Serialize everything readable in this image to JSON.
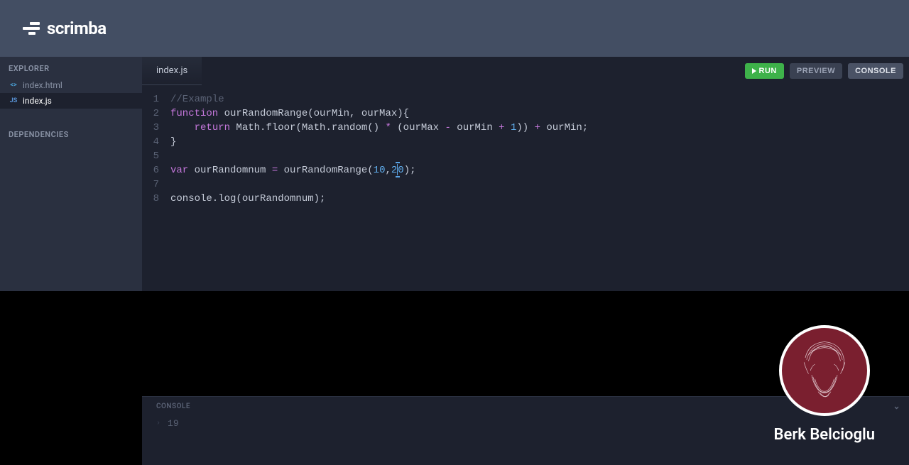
{
  "brand": "scrimba",
  "sidebar": {
    "explorer_label": "EXPLORER",
    "dependencies_label": "DEPENDENCIES",
    "files": [
      {
        "name": "index.html",
        "icon": "<>",
        "type": "html",
        "active": false
      },
      {
        "name": "index.js",
        "icon": "JS",
        "type": "js",
        "active": true
      }
    ]
  },
  "editor": {
    "active_tab": "index.js",
    "buttons": {
      "run": "RUN",
      "preview": "PREVIEW",
      "console": "CONSOLE"
    },
    "code": {
      "line1_comment": "//Example",
      "line2_kw1": "function",
      "line2_rest": " ourRandomRange(ourMin, ourMax){",
      "line3_indent": "    ",
      "line3_kw": "return",
      "line3_a": " Math.floor(Math.random() ",
      "line3_op1": "*",
      "line3_b": " (ourMax ",
      "line3_op2": "-",
      "line3_c": " ourMin ",
      "line3_op3": "+",
      "line3_d": " ",
      "line3_num": "1",
      "line3_e": ")) ",
      "line3_op4": "+",
      "line3_f": " ourMin;",
      "line4": "}",
      "line6_kw": "var",
      "line6_a": " ourRandomnum ",
      "line6_op": "=",
      "line6_b": " ourRandomRange(",
      "line6_n1": "10",
      "line6_c": ",",
      "line6_n2a": "2",
      "line6_n2b": "0",
      "line6_d": ");",
      "line8": "console.log(ourRandomnum);"
    },
    "line_numbers": [
      "1",
      "2",
      "3",
      "4",
      "5",
      "6",
      "7",
      "8"
    ]
  },
  "console": {
    "label": "CONSOLE",
    "output": "19"
  },
  "profile": {
    "name": "Berk Belcioglu"
  }
}
